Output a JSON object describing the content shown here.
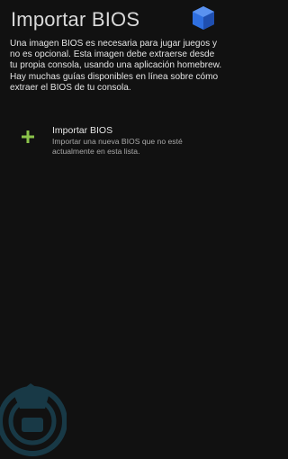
{
  "header": {
    "title": "Importar BIOS",
    "logo_icon": "cube-logo-icon"
  },
  "description": "Una imagen BIOS es necesaria para jugar juegos y no es opcional. Esta imagen debe extraerse desde tu propia consola, usando una aplicación homebrew. Hay muchas guías disponibles en línea sobre cómo extraer el BIOS de tu consola.",
  "actions": [
    {
      "icon": "plus-icon",
      "title": "Importar BIOS",
      "subtitle": "Importar una nueva BIOS que no esté actualmente en esta lista."
    }
  ],
  "colors": {
    "background": "#111111",
    "accent": "#8bc34a",
    "logo": "#2f6fe0",
    "watermark": "#1e5a73"
  },
  "background": {
    "watermark_icon": "app-watermark-icon"
  }
}
